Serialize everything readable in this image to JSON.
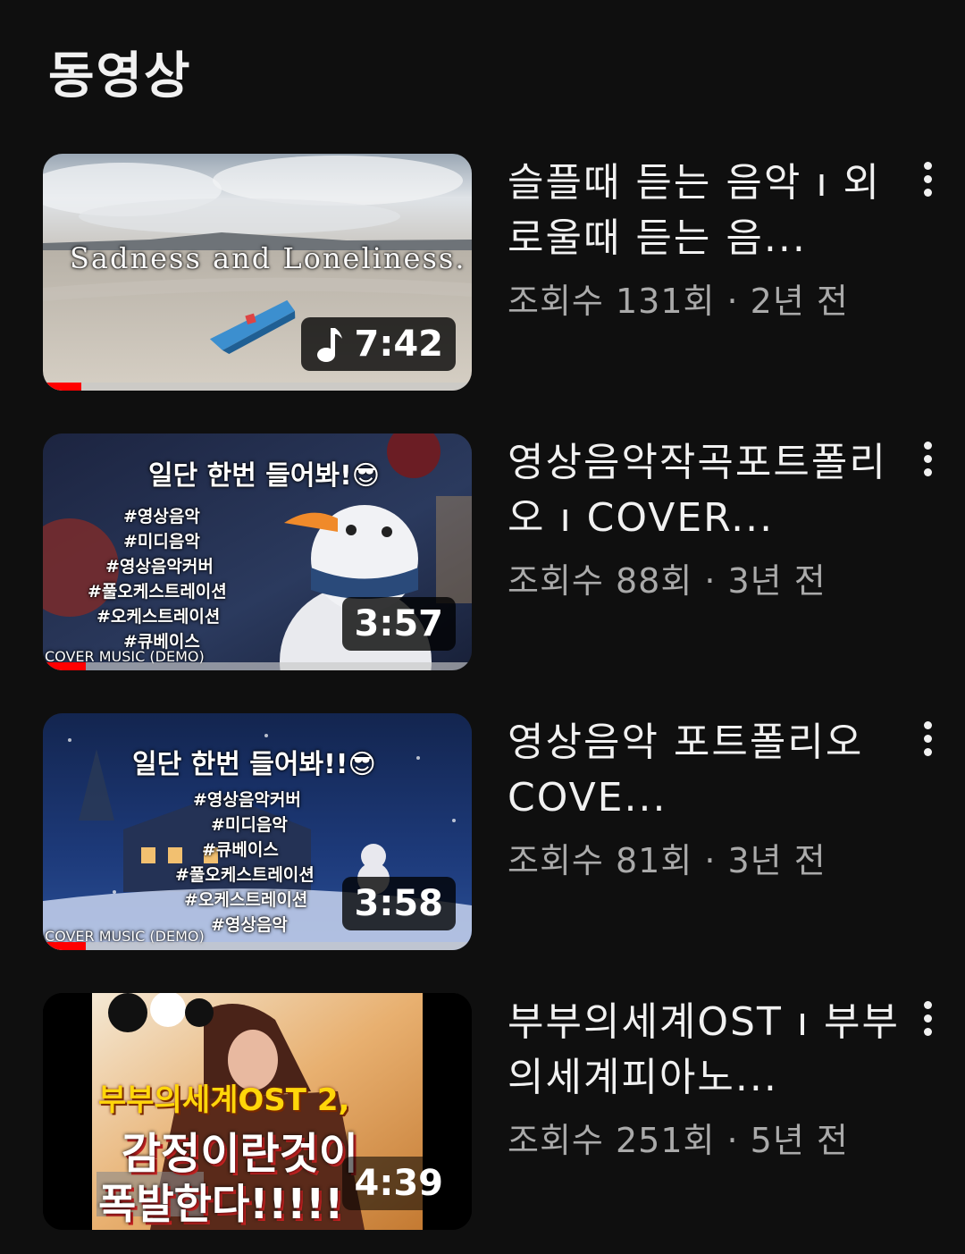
{
  "section": {
    "title": "동영상"
  },
  "videos": [
    {
      "title": "슬플때 듣는 음악 ı 외로울때 듣는 음...",
      "stats": "조회수 131회 · 2년 전",
      "duration": "7:42",
      "has_music_icon": true,
      "watched_progress": 0.09,
      "thumbnail_text": [
        "Sadness and Loneliness."
      ]
    },
    {
      "title": "영상음악작곡포트폴리오 ı COVER...",
      "stats": "조회수 88회 · 3년 전",
      "duration": "3:57",
      "has_music_icon": false,
      "watched_progress": 0.1,
      "thumbnail_text": [
        "일단 한번 들어봐!😎",
        "#영상음악",
        "#미디음악",
        "#영상음악커버",
        "#풀오케스트레이션",
        "#오케스트레이션",
        "#큐베이스",
        "COVER MUSIC (DEMO)"
      ]
    },
    {
      "title": "영상음악 포트폴리오 COVE...",
      "stats": "조회수 81회 · 3년 전",
      "duration": "3:58",
      "has_music_icon": false,
      "watched_progress": 0.1,
      "thumbnail_text": [
        "일단 한번 들어봐!!😎",
        "#영상음악커버",
        "#미디음악",
        "#큐베이스",
        "#풀오케스트레이션",
        "#오케스트레이션",
        "#영상음악",
        "COVER MUSIC (DEMO)"
      ]
    },
    {
      "title": "부부의세계OST ı 부부의세계피아노...",
      "stats": "조회수 251회 · 5년 전",
      "duration": "4:39",
      "has_music_icon": false,
      "watched_progress": 0,
      "thumbnail_text": [
        "부부의세계OST 2,",
        "감정이란것이",
        "폭발한다!!!!!"
      ]
    }
  ],
  "icons": {
    "more": "more-vert-icon",
    "music": "music-note-icon"
  },
  "colors": {
    "background": "#0f0f0f",
    "progress": "#ff0000",
    "secondary_text": "#aaaaaa"
  }
}
